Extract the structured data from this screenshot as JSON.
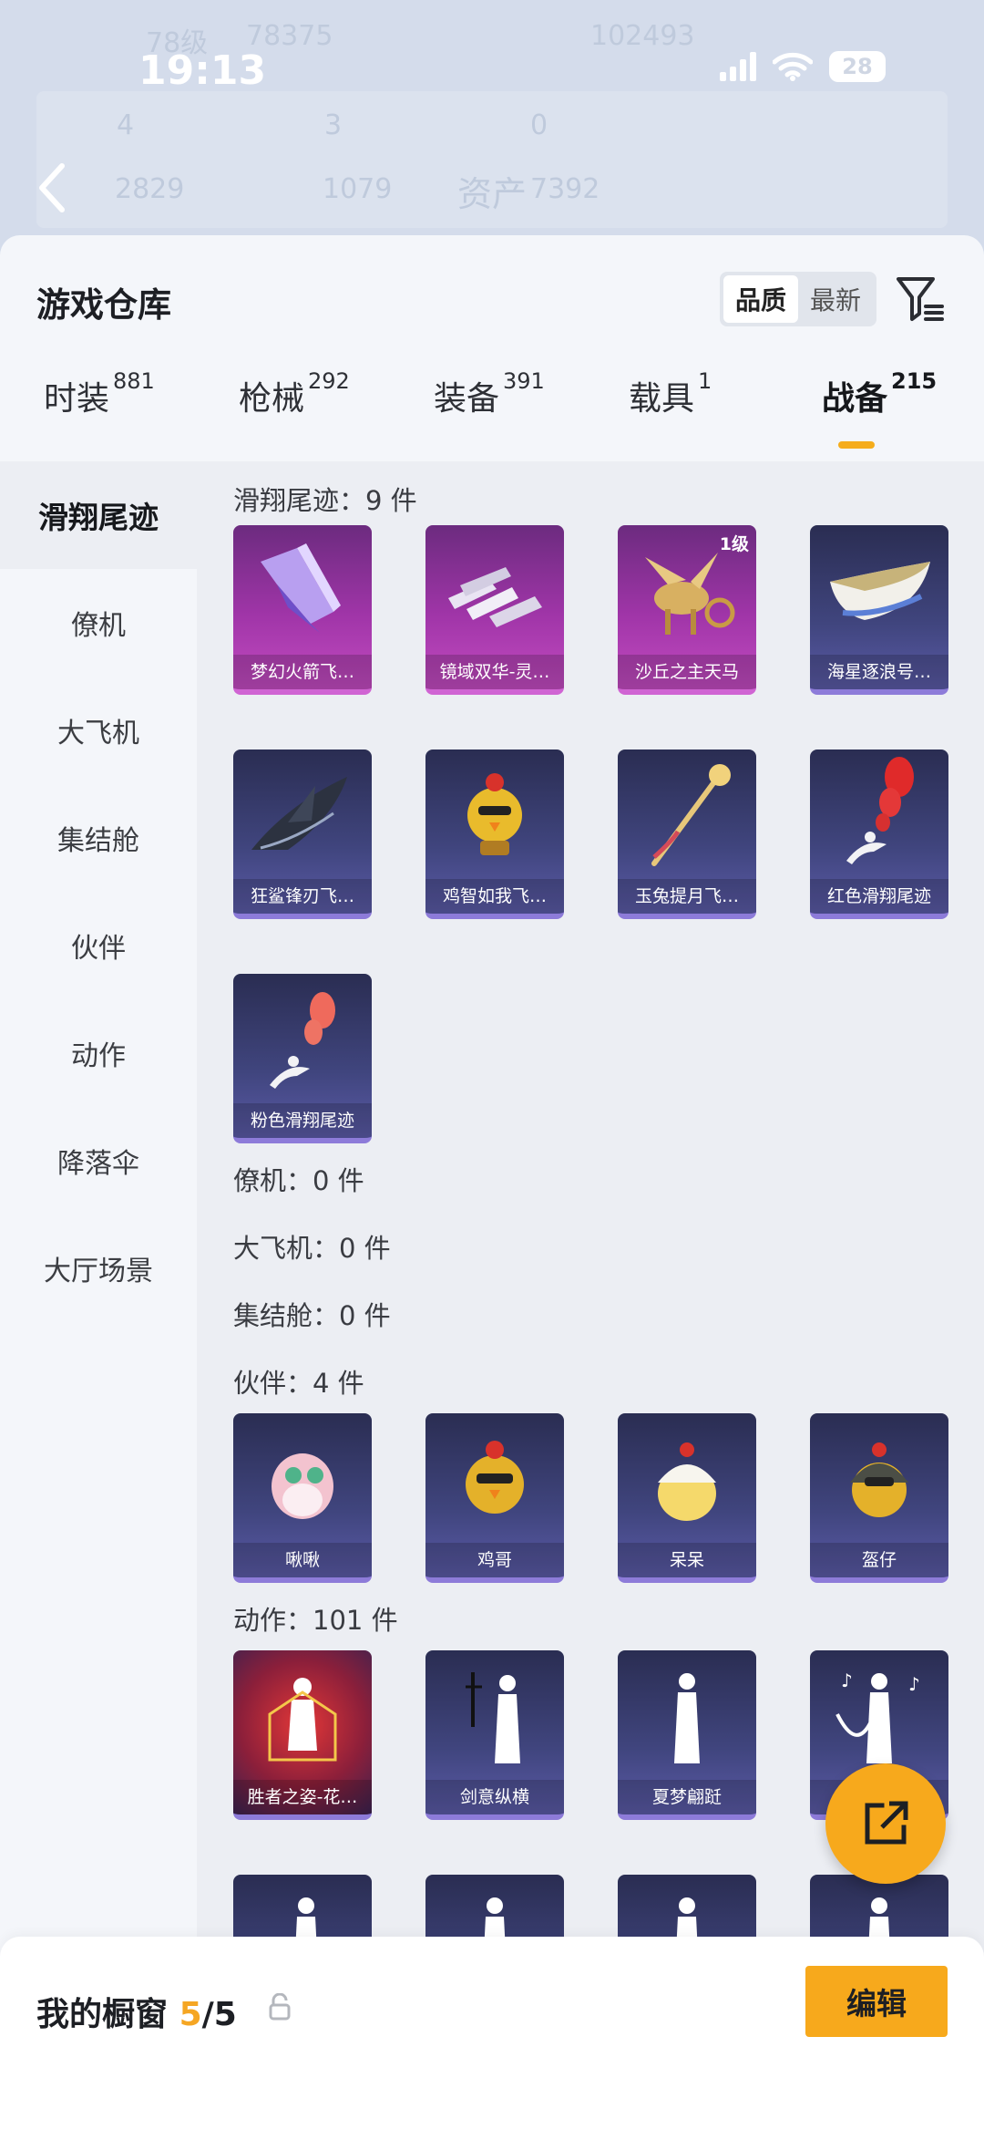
{
  "status_bar": {
    "time": "19:13",
    "battery": "28"
  },
  "background_header": {
    "level": "78级",
    "coins": "78375",
    "other_value": "102493",
    "stat_a": "4",
    "stat_b": "3",
    "stat_c": "0",
    "stat_d": "2829",
    "stat_e": "1079",
    "assets_label": "资产",
    "assets_value": "7392"
  },
  "sheet": {
    "title": "游戏仓库",
    "sort_options": [
      "品质",
      "最新"
    ],
    "selected_sort": "品质"
  },
  "tabs": [
    {
      "label": "时装",
      "count": "881"
    },
    {
      "label": "枪械",
      "count": "292"
    },
    {
      "label": "装备",
      "count": "391"
    },
    {
      "label": "载具",
      "count": "1"
    },
    {
      "label": "战备",
      "count": "215"
    }
  ],
  "active_tab": "战备",
  "sidebar": [
    "滑翔尾迹",
    "僚机",
    "大飞机",
    "集结舱",
    "伙伴",
    "动作",
    "降落伞",
    "大厅场景"
  ],
  "sections": {
    "trail": {
      "title": "滑翔尾迹：9 件",
      "items": [
        {
          "name": "梦幻火箭飞…",
          "badge": ""
        },
        {
          "name": "镜域双华-灵…",
          "badge": ""
        },
        {
          "name": "沙丘之主天马",
          "badge": "1级"
        },
        {
          "name": "海星逐浪号…",
          "badge": ""
        },
        {
          "name": "狂鲨锋刃飞…",
          "badge": ""
        },
        {
          "name": "鸡智如我飞…",
          "badge": ""
        },
        {
          "name": "玉兔提月飞…",
          "badge": ""
        },
        {
          "name": "红色滑翔尾迹",
          "badge": ""
        },
        {
          "name": "粉色滑翔尾迹",
          "badge": ""
        }
      ]
    },
    "wingman": {
      "title": "僚机：0 件"
    },
    "airplane": {
      "title": "大飞机：0 件"
    },
    "pod": {
      "title": "集结舱：0 件"
    },
    "partner": {
      "title": "伙伴：4 件",
      "items": [
        {
          "name": "啾啾"
        },
        {
          "name": "鸡哥"
        },
        {
          "name": "呆呆"
        },
        {
          "name": "盔仔"
        }
      ]
    },
    "emote": {
      "title": "动作：101 件",
      "items": [
        {
          "name": "胜者之姿-花…"
        },
        {
          "name": "剑意纵横"
        },
        {
          "name": "夏梦翩跹"
        },
        {
          "name": ""
        }
      ]
    }
  },
  "showcase": {
    "label": "我的橱窗",
    "current": "5",
    "total": "/5"
  },
  "edit_button": "编辑"
}
